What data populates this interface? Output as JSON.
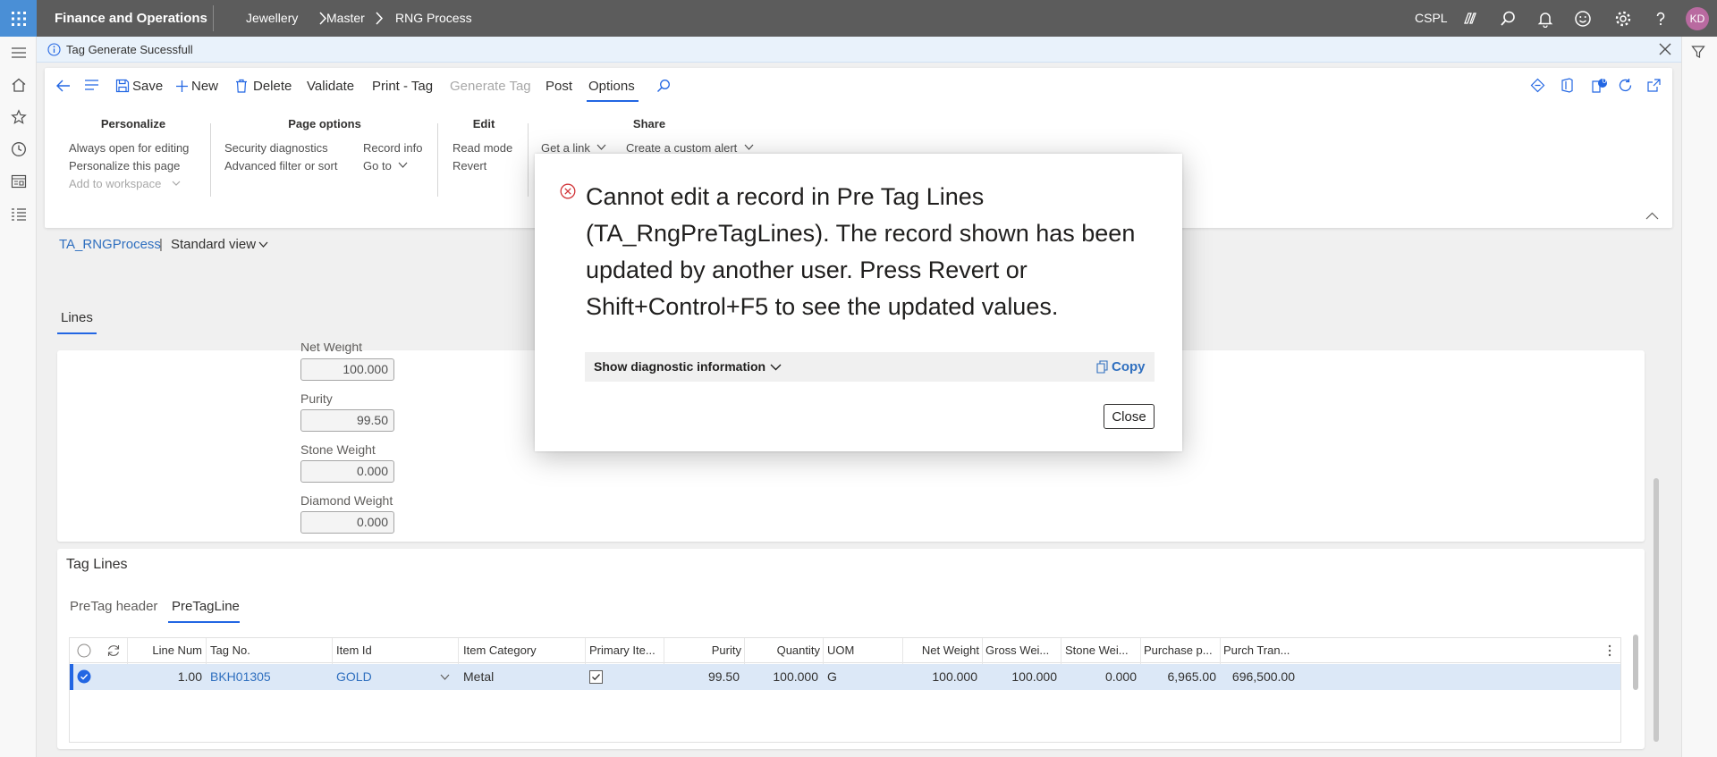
{
  "topbar": {
    "app_title": "Finance and Operations",
    "breadcrumbs": [
      "Jewellery",
      "Master",
      "RNG Process"
    ],
    "company": "CSPL",
    "avatar_initials": "KD",
    "colors": {
      "bar": "#5c5c5c",
      "waffle": "#4a8fd6",
      "avatar": "#b96aa0"
    }
  },
  "message_bar": {
    "text": "Tag Generate Sucessfull"
  },
  "action_pane": {
    "buttons": {
      "save": "Save",
      "new": "New",
      "delete": "Delete",
      "validate": "Validate",
      "print_tag": "Print - Tag",
      "generate_tag": "Generate Tag",
      "post": "Post",
      "options": "Options"
    },
    "groups": {
      "personalize": {
        "title": "Personalize",
        "items": [
          "Always open for editing",
          "Personalize this page",
          "Add to workspace"
        ]
      },
      "page_options": {
        "title": "Page options",
        "items": [
          "Security diagnostics",
          "Advanced filter or sort",
          "Record info",
          "Go to"
        ]
      },
      "edit": {
        "title": "Edit",
        "items": [
          "Read mode",
          "Revert"
        ]
      },
      "share": {
        "title": "Share",
        "items": [
          "Get a link",
          "Create a custom alert"
        ]
      }
    },
    "notification_count": "0"
  },
  "page": {
    "form_name": "TA_RNGProcess",
    "separator": "|",
    "view": "Standard view",
    "lines_tab": "Lines"
  },
  "details": {
    "fields": [
      {
        "label": "Net Weight",
        "value": "100.000"
      },
      {
        "label": "Purity",
        "value": "99.50"
      },
      {
        "label": "Stone Weight",
        "value": "0.000"
      },
      {
        "label": "Diamond Weight",
        "value": "0.000"
      }
    ]
  },
  "tag_lines": {
    "title": "Tag Lines",
    "tabs": [
      "PreTag header",
      "PreTagLine"
    ],
    "columns": [
      "Line Num",
      "Tag No.",
      "Item Id",
      "Item Category",
      "Primary Ite...",
      "Purity",
      "Quantity",
      "UOM",
      "Net Weight",
      "Gross Wei...",
      "Stone Wei...",
      "Purchase p...",
      "Purch Tran..."
    ],
    "rows": [
      {
        "line_num": "1.00",
        "tag_no": "BKH01305",
        "item_id": "GOLD",
        "item_category": "Metal",
        "primary_item": true,
        "purity": "99.50",
        "quantity": "100.000",
        "uom": "G",
        "net_weight": "100.000",
        "gross_weight": "100.000",
        "stone_weight": "0.000",
        "purchase_price": "6,965.00",
        "purch_tran": "696,500.00"
      }
    ]
  },
  "dialog": {
    "message": "Cannot edit a record in Pre Tag Lines (TA_RngPreTagLines). The record shown has been updated by another user. Press Revert or Shift+Control+F5 to see the updated values.",
    "diagnostic_label": "Show diagnostic information",
    "copy_label": "Copy",
    "close_label": "Close",
    "error_color": "#d13438"
  }
}
